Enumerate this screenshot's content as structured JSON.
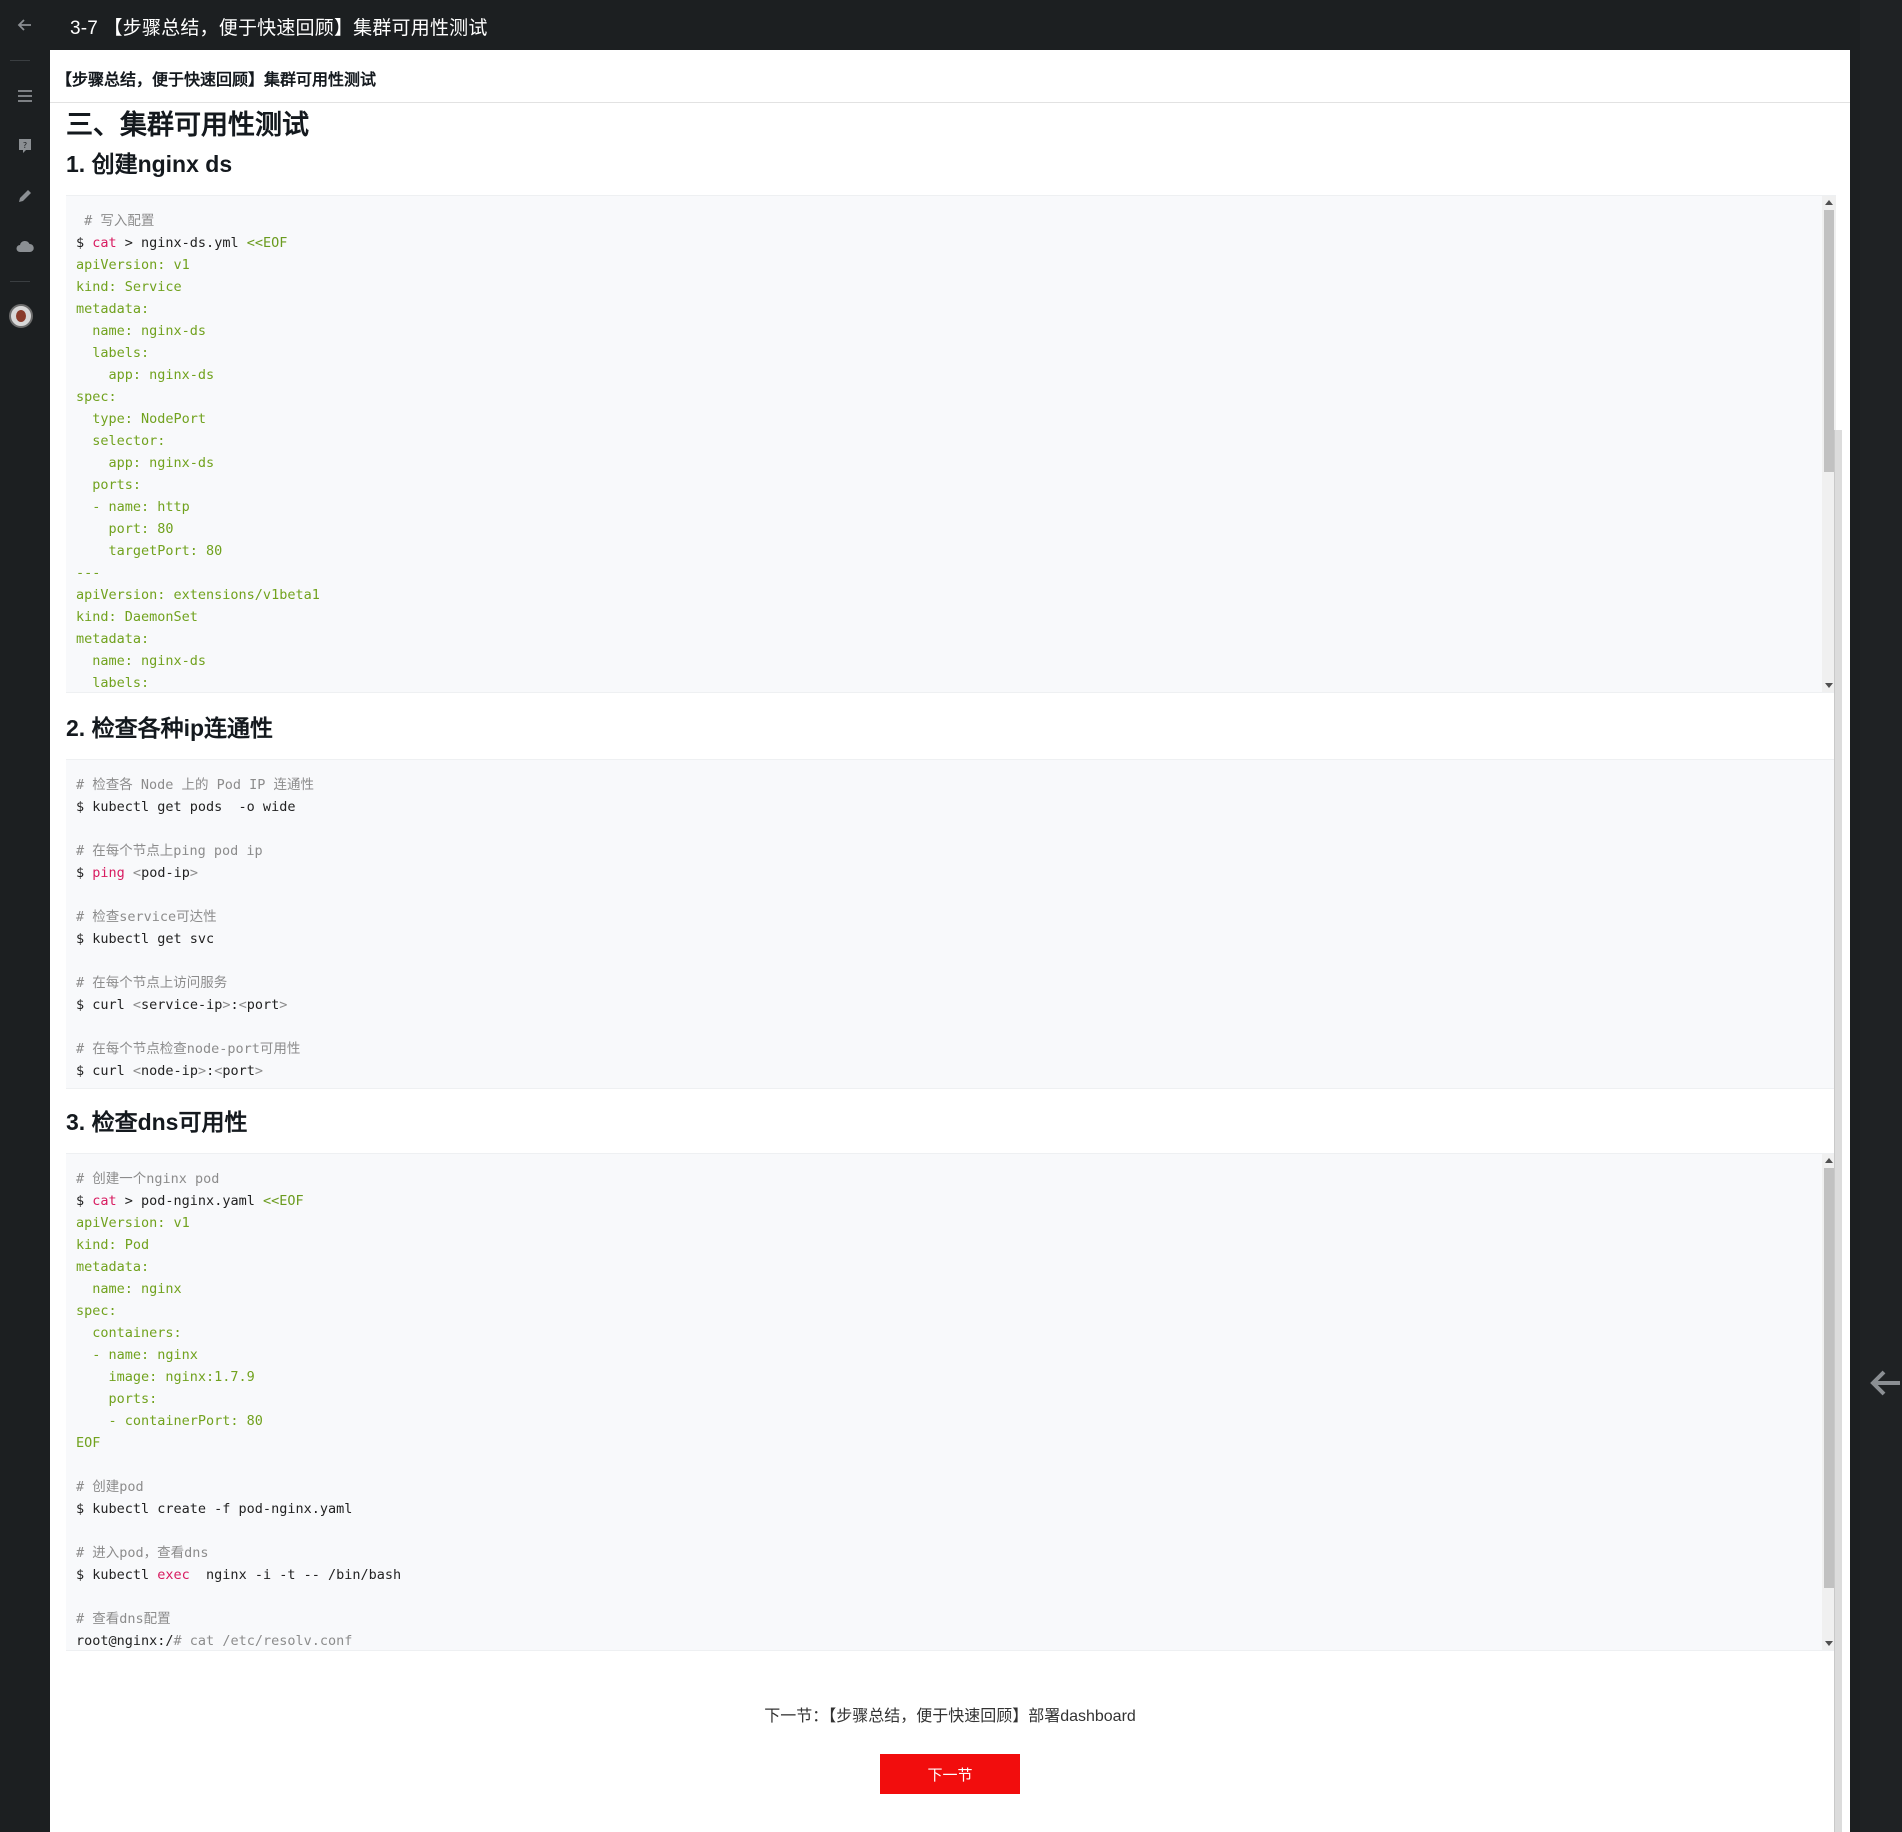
{
  "topbar": {
    "title": "3-7 【步骤总结，便于快速回顾】集群可用性测试"
  },
  "left_rail": {
    "icons": [
      "back-arrow-icon",
      "menu-icon",
      "question-icon",
      "edit-icon",
      "cloud-icon",
      "avatar"
    ]
  },
  "page_header": {
    "title": "【步骤总结，便于快速回顾】集群可用性测试"
  },
  "article": {
    "h1": "三、集群可用性测试",
    "sections": [
      {
        "heading": "1. 创建nginx ds"
      },
      {
        "heading": "2. 检查各种ip连通性"
      },
      {
        "heading": "3. 检查dns可用性"
      }
    ]
  },
  "code_blocks": [
    {
      "lines": [
        [
          [
            "c",
            " # 写入配置"
          ]
        ],
        [
          [
            "n",
            "$ "
          ],
          [
            "k",
            "cat"
          ],
          [
            "n",
            " > nginx-ds.yml "
          ],
          [
            "s",
            "<<EOF"
          ]
        ],
        [
          [
            "y",
            "apiVersion: v1"
          ]
        ],
        [
          [
            "y",
            "kind: Service"
          ]
        ],
        [
          [
            "y",
            "metadata:"
          ]
        ],
        [
          [
            "y",
            "  name: nginx-ds"
          ]
        ],
        [
          [
            "y",
            "  labels:"
          ]
        ],
        [
          [
            "y",
            "    app: nginx-ds"
          ]
        ],
        [
          [
            "y",
            "spec:"
          ]
        ],
        [
          [
            "y",
            "  type: NodePort"
          ]
        ],
        [
          [
            "y",
            "  selector:"
          ]
        ],
        [
          [
            "y",
            "    app: nginx-ds"
          ]
        ],
        [
          [
            "y",
            "  ports:"
          ]
        ],
        [
          [
            "y",
            "  - name: http"
          ]
        ],
        [
          [
            "y",
            "    port: 80"
          ]
        ],
        [
          [
            "y",
            "    targetPort: 80"
          ]
        ],
        [
          [
            "y",
            "---"
          ]
        ],
        [
          [
            "y",
            "apiVersion: extensions/v1beta1"
          ]
        ],
        [
          [
            "y",
            "kind: DaemonSet"
          ]
        ],
        [
          [
            "y",
            "metadata:"
          ]
        ],
        [
          [
            "y",
            "  name: nginx-ds"
          ]
        ],
        [
          [
            "y",
            "  labels:"
          ]
        ]
      ]
    },
    {
      "lines": [
        [
          [
            "c",
            "# 检查各 Node 上的 Pod IP 连通性"
          ]
        ],
        [
          [
            "n",
            "$ kubectl get pods  -o wide"
          ]
        ],
        [
          [
            "n",
            ""
          ]
        ],
        [
          [
            "c",
            "# 在每个节点上ping pod ip"
          ]
        ],
        [
          [
            "n",
            "$ "
          ],
          [
            "k",
            "ping"
          ],
          [
            "n",
            " "
          ],
          [
            "c",
            "<"
          ],
          [
            "n",
            "pod-ip"
          ],
          [
            "c",
            ">"
          ]
        ],
        [
          [
            "n",
            ""
          ]
        ],
        [
          [
            "c",
            "# 检查service可达性"
          ]
        ],
        [
          [
            "n",
            "$ kubectl get svc"
          ]
        ],
        [
          [
            "n",
            ""
          ]
        ],
        [
          [
            "c",
            "# 在每个节点上访问服务"
          ]
        ],
        [
          [
            "n",
            "$ curl "
          ],
          [
            "c",
            "<"
          ],
          [
            "n",
            "service-ip"
          ],
          [
            "c",
            ">"
          ],
          [
            "n",
            ":"
          ],
          [
            "c",
            "<"
          ],
          [
            "n",
            "port"
          ],
          [
            "c",
            ">"
          ]
        ],
        [
          [
            "n",
            ""
          ]
        ],
        [
          [
            "c",
            "# 在每个节点检查node-port可用性"
          ]
        ],
        [
          [
            "n",
            "$ curl "
          ],
          [
            "c",
            "<"
          ],
          [
            "n",
            "node-ip"
          ],
          [
            "c",
            ">"
          ],
          [
            "n",
            ":"
          ],
          [
            "c",
            "<"
          ],
          [
            "n",
            "port"
          ],
          [
            "c",
            ">"
          ]
        ]
      ]
    },
    {
      "lines": [
        [
          [
            "c",
            "# 创建一个nginx pod"
          ]
        ],
        [
          [
            "n",
            "$ "
          ],
          [
            "k",
            "cat"
          ],
          [
            "n",
            " > pod-nginx.yaml "
          ],
          [
            "s",
            "<<EOF"
          ]
        ],
        [
          [
            "y",
            "apiVersion: v1"
          ]
        ],
        [
          [
            "y",
            "kind: Pod"
          ]
        ],
        [
          [
            "y",
            "metadata:"
          ]
        ],
        [
          [
            "y",
            "  name: nginx"
          ]
        ],
        [
          [
            "y",
            "spec:"
          ]
        ],
        [
          [
            "y",
            "  containers:"
          ]
        ],
        [
          [
            "y",
            "  - name: nginx"
          ]
        ],
        [
          [
            "y",
            "    image: nginx:1.7.9"
          ]
        ],
        [
          [
            "y",
            "    ports:"
          ]
        ],
        [
          [
            "y",
            "    - containerPort: 80"
          ]
        ],
        [
          [
            "y",
            "EOF"
          ]
        ],
        [
          [
            "n",
            ""
          ]
        ],
        [
          [
            "c",
            "# 创建pod"
          ]
        ],
        [
          [
            "n",
            "$ kubectl create -f pod-nginx.yaml"
          ]
        ],
        [
          [
            "n",
            ""
          ]
        ],
        [
          [
            "c",
            "# 进入pod，查看dns"
          ]
        ],
        [
          [
            "n",
            "$ kubectl "
          ],
          [
            "k",
            "exec"
          ],
          [
            "n",
            "  nginx -i -t -- /bin/bash"
          ]
        ],
        [
          [
            "n",
            ""
          ]
        ],
        [
          [
            "c",
            "# 查看dns配置"
          ]
        ],
        [
          [
            "n",
            "root@nginx:/"
          ],
          [
            "c",
            "# cat /etc/resolv.conf"
          ]
        ]
      ]
    }
  ],
  "footer": {
    "next_label": "下一节：【步骤总结，便于快速回顾】部署dashboard",
    "next_button": "下一节"
  },
  "colors": {
    "background_dark": "#1c1f21",
    "accent_red": "#f20d0d",
    "code_bg": "#f8f9fb",
    "yaml_green": "#71a21e",
    "keyword_pink": "#d81b60",
    "comment_gray": "#8c8c8c"
  }
}
